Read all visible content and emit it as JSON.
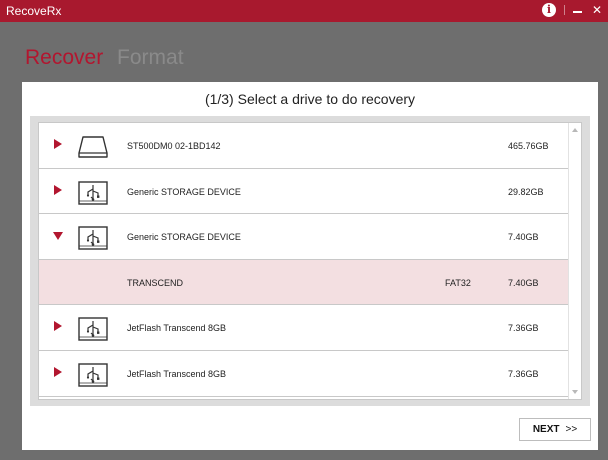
{
  "window": {
    "title": "RecoveRx"
  },
  "titlebar": {
    "info_icon": "info-icon",
    "minimize_icon": "minimize-icon",
    "close_icon": "close-icon"
  },
  "nav": {
    "tabs": [
      {
        "label": "Recover",
        "active": true
      },
      {
        "label": "Format",
        "active": false
      }
    ]
  },
  "panel": {
    "title": "(1/3) Select a drive to do recovery",
    "next_label": "NEXT",
    "next_glyph": ">>"
  },
  "drives": [
    {
      "expander": "collapsed",
      "icon": "hard-disk-icon",
      "name": "ST500DM0 02-1BD142",
      "fs": "",
      "size": "465.76GB",
      "selected": false
    },
    {
      "expander": "collapsed",
      "icon": "usb-drive-icon",
      "name": "Generic STORAGE DEVICE",
      "fs": "",
      "size": "29.82GB",
      "selected": false
    },
    {
      "expander": "expanded",
      "icon": "usb-drive-icon",
      "name": "Generic STORAGE DEVICE",
      "fs": "",
      "size": "7.40GB",
      "selected": false
    },
    {
      "expander": "none",
      "icon": "",
      "name": "TRANSCEND",
      "fs": "FAT32",
      "size": "7.40GB",
      "selected": true
    },
    {
      "expander": "collapsed",
      "icon": "usb-drive-icon",
      "name": "JetFlash Transcend 8GB",
      "fs": "",
      "size": "7.36GB",
      "selected": false
    },
    {
      "expander": "collapsed",
      "icon": "usb-drive-icon",
      "name": "JetFlash Transcend 8GB",
      "fs": "",
      "size": "7.36GB",
      "selected": false
    }
  ],
  "colors": {
    "accent": "#a8192e",
    "selected_row": "#f3dfe1",
    "tab_inactive": "#8a8a8a"
  }
}
